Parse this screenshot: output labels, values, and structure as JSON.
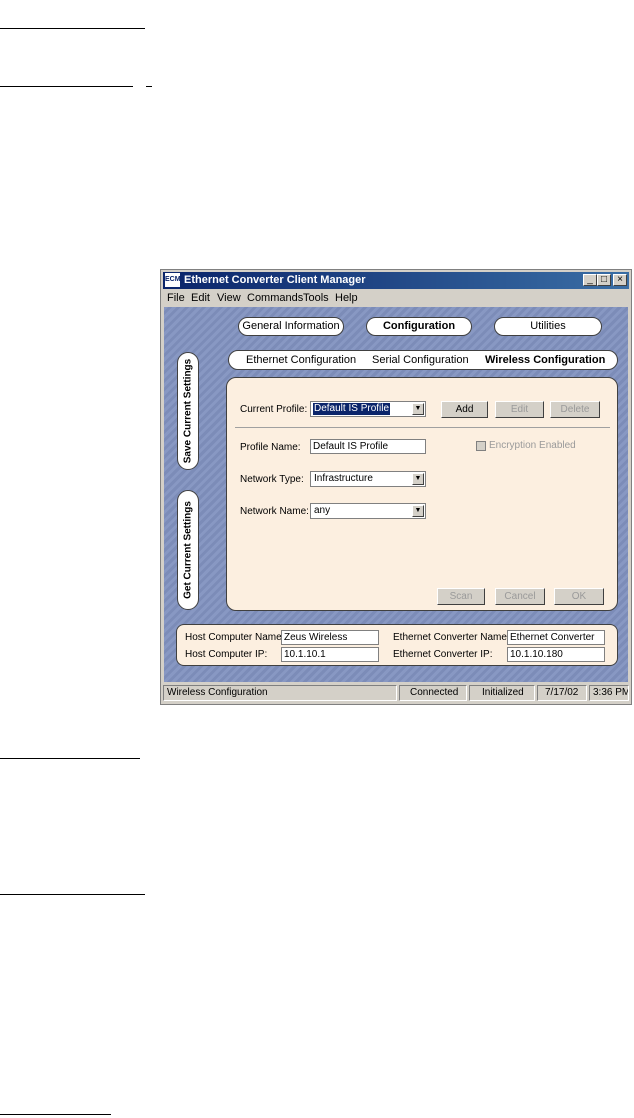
{
  "window": {
    "title": "Ethernet Converter Client Manager",
    "app_icon_text": "ECM",
    "controls": {
      "minimize": "_",
      "maximize": "□",
      "close": "×"
    }
  },
  "menu": [
    "File",
    "Edit",
    "View",
    "Commands",
    "Tools",
    "Help"
  ],
  "main_tabs": [
    {
      "label": "General Information",
      "active": false
    },
    {
      "label": "Configuration",
      "active": true
    },
    {
      "label": "Utilities",
      "active": false
    }
  ],
  "sub_tabs": [
    {
      "label": "Ethernet Configuration",
      "active": false
    },
    {
      "label": "Serial Configuration",
      "active": false
    },
    {
      "label": "Wireless Configuration",
      "active": true
    }
  ],
  "side_buttons": {
    "save": "Save Current Settings",
    "get": "Get Current Settings"
  },
  "wireless": {
    "current_profile_label": "Current Profile:",
    "current_profile_value": "Default IS Profile",
    "add_label": "Add",
    "edit_label": "Edit",
    "delete_label": "Delete",
    "profile_name_label": "Profile Name:",
    "profile_name_value": "Default IS Profile",
    "encryption_label": "Encryption Enabled",
    "encryption_enabled": false,
    "network_type_label": "Network Type:",
    "network_type_value": "Infrastructure",
    "network_name_label": "Network Name:",
    "network_name_value": "any",
    "scan_label": "Scan",
    "cancel_label": "Cancel",
    "ok_label": "OK"
  },
  "host_info": {
    "host_name_label": "Host Computer Name:",
    "host_name_value": "Zeus Wireless",
    "host_ip_label": "Host Computer IP:",
    "host_ip_value": "10.1.10.1",
    "converter_name_label": "Ethernet Converter Name:",
    "converter_name_value": "Ethernet Converter",
    "converter_ip_label": "Ethernet Converter IP:",
    "converter_ip_value": "10.1.10.180"
  },
  "status_bar": {
    "panel": "Wireless Configuration",
    "connection": "Connected",
    "state": "Initialized",
    "date": "7/17/02",
    "time": "3:36 PM"
  }
}
